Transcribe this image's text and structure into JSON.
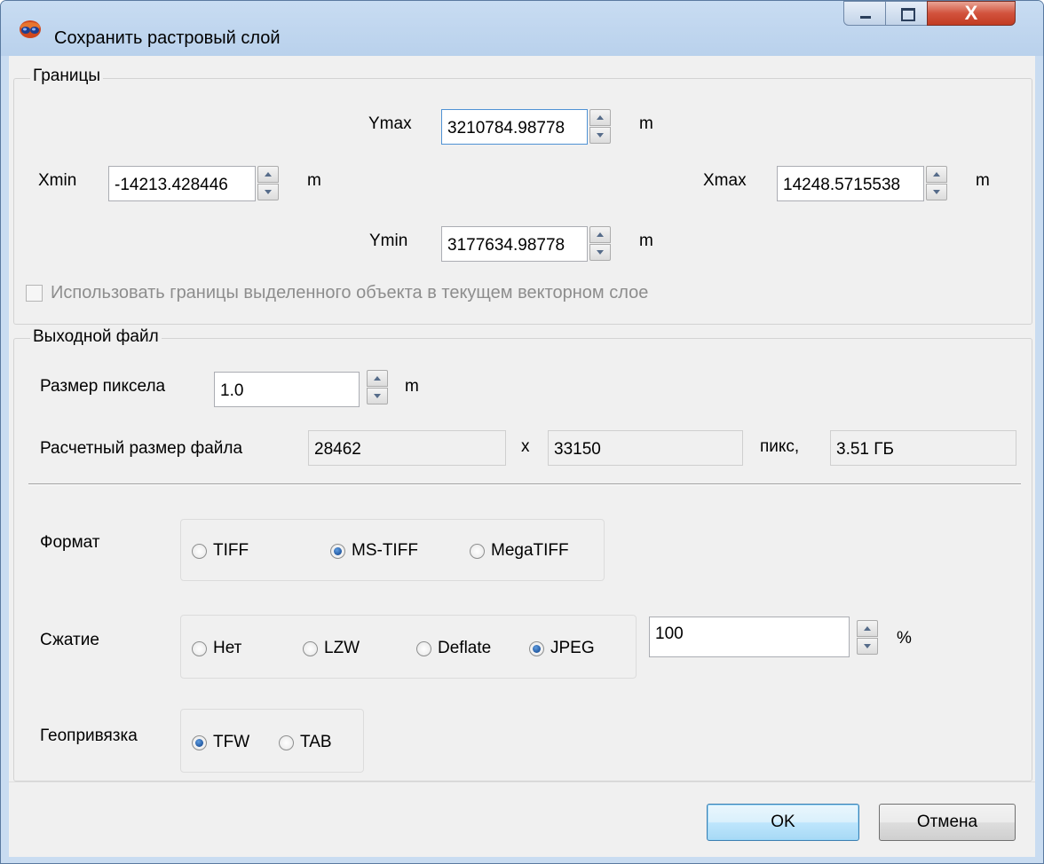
{
  "window": {
    "title": "Сохранить растровый слой",
    "close_glyph": "X",
    "icon": "app-logo-icon"
  },
  "bounds": {
    "title": "Границы",
    "ymax": {
      "label": "Ymax",
      "value": "3210784.98778",
      "unit": "m"
    },
    "xmin": {
      "label": "Xmin",
      "value": "-14213.428446",
      "unit": "m"
    },
    "xmax": {
      "label": "Xmax",
      "value": "14248.5715538",
      "unit": "m"
    },
    "ymin": {
      "label": "Ymin",
      "value": "3177634.98778",
      "unit": "m"
    },
    "use_selection": {
      "label": "Использовать границы выделенного объекта в текущем векторном слое",
      "checked": false,
      "enabled": false
    }
  },
  "output": {
    "title": "Выходной файл",
    "pixel_size": {
      "label": "Размер пиксела",
      "value": "1.0",
      "unit": "m"
    },
    "file_size": {
      "label": "Расчетный размер файла",
      "width": "28462",
      "sep": "x",
      "height": "33150",
      "unit": "пикс,",
      "size": "3.51 ГБ"
    },
    "format": {
      "label": "Формат",
      "options": [
        "TIFF",
        "MS-TIFF",
        "MegaTIFF"
      ],
      "selected": "MS-TIFF"
    },
    "compression": {
      "label": "Сжатие",
      "options": [
        "Нет",
        "LZW",
        "Deflate",
        "JPEG"
      ],
      "selected": "JPEG",
      "quality": "100",
      "quality_unit": "%"
    },
    "georef": {
      "label": "Геопривязка",
      "options": [
        "TFW",
        "TAB"
      ],
      "selected": "TFW"
    }
  },
  "buttons": {
    "ok": "OK",
    "cancel": "Отмена"
  }
}
